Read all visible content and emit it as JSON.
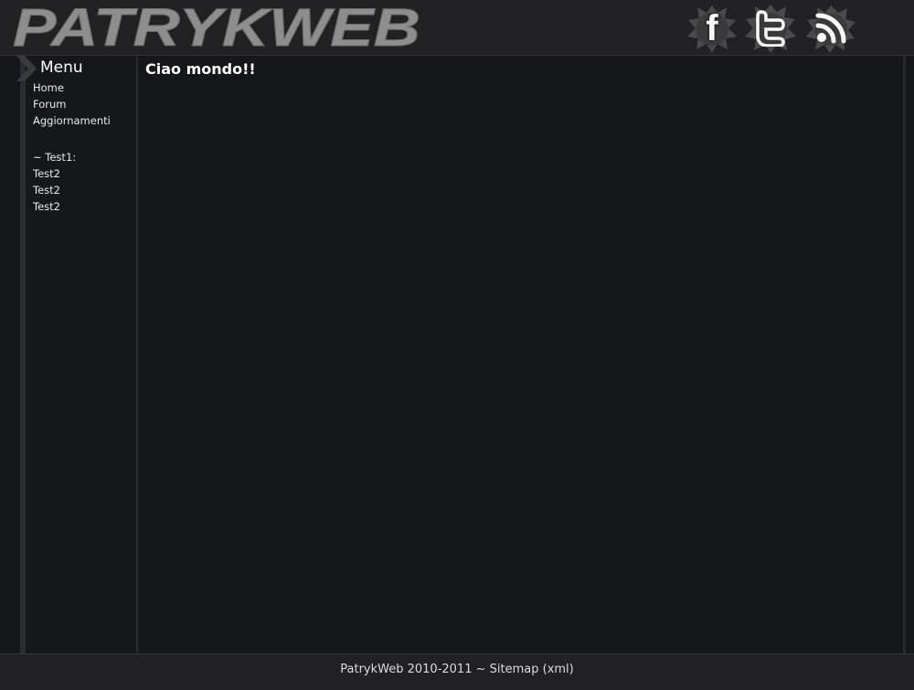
{
  "header": {
    "logo_text": "PATRYKWEB",
    "social": [
      {
        "name": "facebook",
        "icon": "facebook-icon",
        "glyph": "f"
      },
      {
        "name": "twitter",
        "icon": "twitter-icon",
        "glyph": "t"
      },
      {
        "name": "rss",
        "icon": "rss-icon",
        "glyph": "rss"
      }
    ]
  },
  "sidebar": {
    "title": "Menu",
    "links": [
      "Home",
      "Forum",
      "Aggiornamenti"
    ],
    "section_label": "~ Test1:",
    "section_links": [
      "Test2",
      "Test2",
      "Test2"
    ]
  },
  "main": {
    "heading": "Ciao mondo!!"
  },
  "footer": {
    "text": "PatrykWeb 2010-2011 ~ ",
    "sitemap": "Sitemap",
    "xml": "(xml)"
  },
  "colors": {
    "background": "#16171b",
    "header": "#222224",
    "logo": "#8e8e8e",
    "text": "#e9e9e9"
  }
}
